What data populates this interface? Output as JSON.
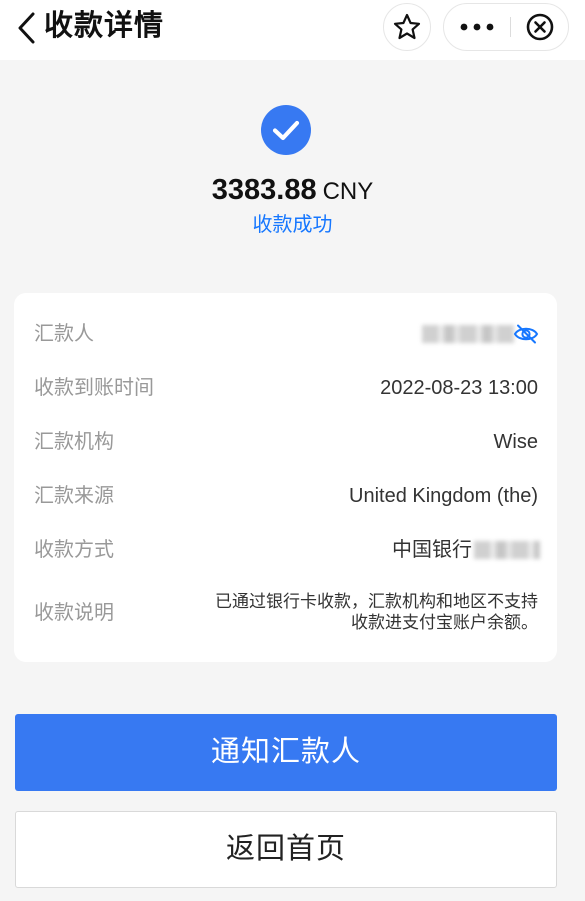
{
  "navbar": {
    "title": "收款详情",
    "back_icon": "chevron-left-icon",
    "favorite_icon": "star-icon",
    "more_icon": "more-icon",
    "close_icon": "close-circle-icon"
  },
  "result": {
    "status_icon": "check-circle-icon",
    "status_color": "#3779f2",
    "amount": "3383.88",
    "currency": "CNY",
    "status_text": "收款成功"
  },
  "details": {
    "rows": [
      {
        "label": "汇款人",
        "value": ""
      },
      {
        "label": "收款到账时间",
        "value": "2022-08-23 13:00"
      },
      {
        "label": "汇款机构",
        "value": "Wise"
      },
      {
        "label": "汇款来源",
        "value": "United Kingdom (the)"
      },
      {
        "label": "收款方式",
        "value": "中国银行"
      },
      {
        "label": "收款说明",
        "value": "已通过银行卡收款，汇款机构和地区不支持收款进支付宝账户余额。"
      }
    ],
    "eye_icon": "eye-hidden-icon"
  },
  "actions": {
    "primary_label": "通知汇款人",
    "secondary_label": "返回首页",
    "primary_color": "#3779f2"
  }
}
